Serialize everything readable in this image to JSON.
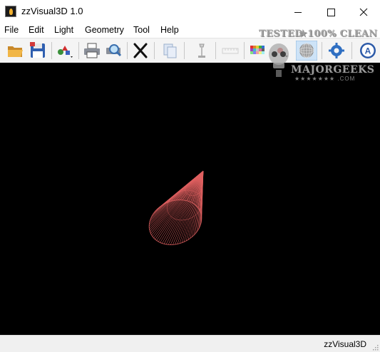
{
  "window": {
    "title": "zzVisual3D 1.0"
  },
  "menu": {
    "items": [
      "File",
      "Edit",
      "Light",
      "Geometry",
      "Tool",
      "Help"
    ]
  },
  "toolbar": {
    "buttons": [
      {
        "icon": "open-folder-icon"
      },
      {
        "icon": "save-icon"
      },
      {
        "icon": "shapes-dropdown-icon"
      },
      {
        "icon": "print-icon"
      },
      {
        "icon": "print-preview-icon"
      },
      {
        "icon": "scissors-icon"
      },
      {
        "icon": "copy-icon"
      },
      {
        "icon": "lamp-icon"
      },
      {
        "icon": "ruler-icon"
      },
      {
        "icon": "color-palette-icon"
      },
      {
        "icon": "point-dropdown-icon"
      },
      {
        "icon": "wireframe-sphere-icon"
      },
      {
        "icon": "gear-icon"
      },
      {
        "icon": "about-icon"
      }
    ]
  },
  "viewport": {
    "background": "#000000",
    "model_color": "#e06060"
  },
  "status": {
    "text": "zzVisual3D"
  },
  "watermark": {
    "line1": "TESTED",
    "line1b": "★100% CLEAN",
    "line2": "MAJORGEEKS",
    "line3": "★★★★★★★ .COM"
  }
}
